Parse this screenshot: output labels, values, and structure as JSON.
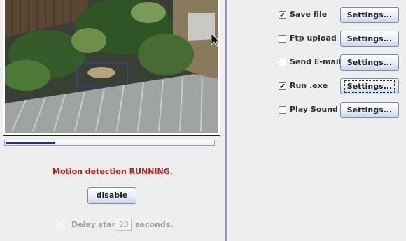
{
  "motion": {
    "status_text": "Motion detection RUNNING.",
    "disable_label": "disable",
    "progress_fraction": 0.24,
    "delay_label": "Delay start",
    "delay_value": "20",
    "delay_unit": "seconds.",
    "delay_checked": false,
    "colors": {
      "status": "#c81a1a",
      "progress": "#1a2dbf"
    }
  },
  "actions": [
    {
      "label": "Save file",
      "checked": true,
      "button_label": "Settings..."
    },
    {
      "label": "Ftp upload",
      "checked": false,
      "button_label": "Settings..."
    },
    {
      "label": "Send E-mail",
      "checked": false,
      "button_label": "Settings..."
    },
    {
      "label": "Run .exe",
      "checked": true,
      "button_label": "Settings..."
    },
    {
      "label": "Play Sound",
      "checked": false,
      "button_label": "Settings..."
    }
  ]
}
